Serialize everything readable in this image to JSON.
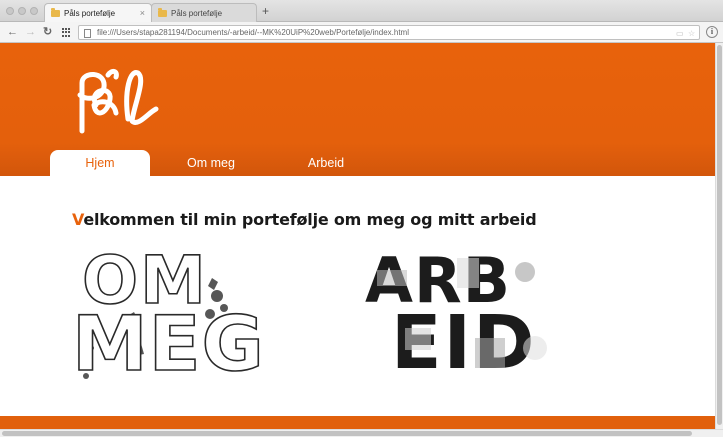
{
  "browser": {
    "tabs": [
      {
        "label": "Påls portefølje",
        "active": true
      },
      {
        "label": "Påls portefølje",
        "active": false
      }
    ],
    "new_tab_label": "+",
    "url": "file:///Users/stapa281194/Documents/-arbeid/--MK%20UiP%20web/Portefølje/index.html",
    "icons": {
      "back": "back-arrow-icon",
      "forward": "forward-arrow-icon",
      "reload": "reload-icon",
      "apps": "apps-grid-icon",
      "file": "file-icon",
      "info": "info-icon"
    }
  },
  "site": {
    "logo_text": "Pål",
    "nav": [
      {
        "label": "Hjem",
        "active": true
      },
      {
        "label": "Om meg",
        "active": false
      },
      {
        "label": "Arbeid",
        "active": false
      }
    ],
    "heading_first_letter": "V",
    "heading_rest": "elkommen til min portefølje om meg og mitt arbeid",
    "links": {
      "om_meg": {
        "line1": "OM",
        "line2": "MEG"
      },
      "arbeid": {
        "line1": "ARB",
        "line2": "EID"
      }
    },
    "colors": {
      "brand_orange": "#e8620c",
      "white": "#ffffff",
      "dark_text": "#1a1a1a"
    }
  }
}
